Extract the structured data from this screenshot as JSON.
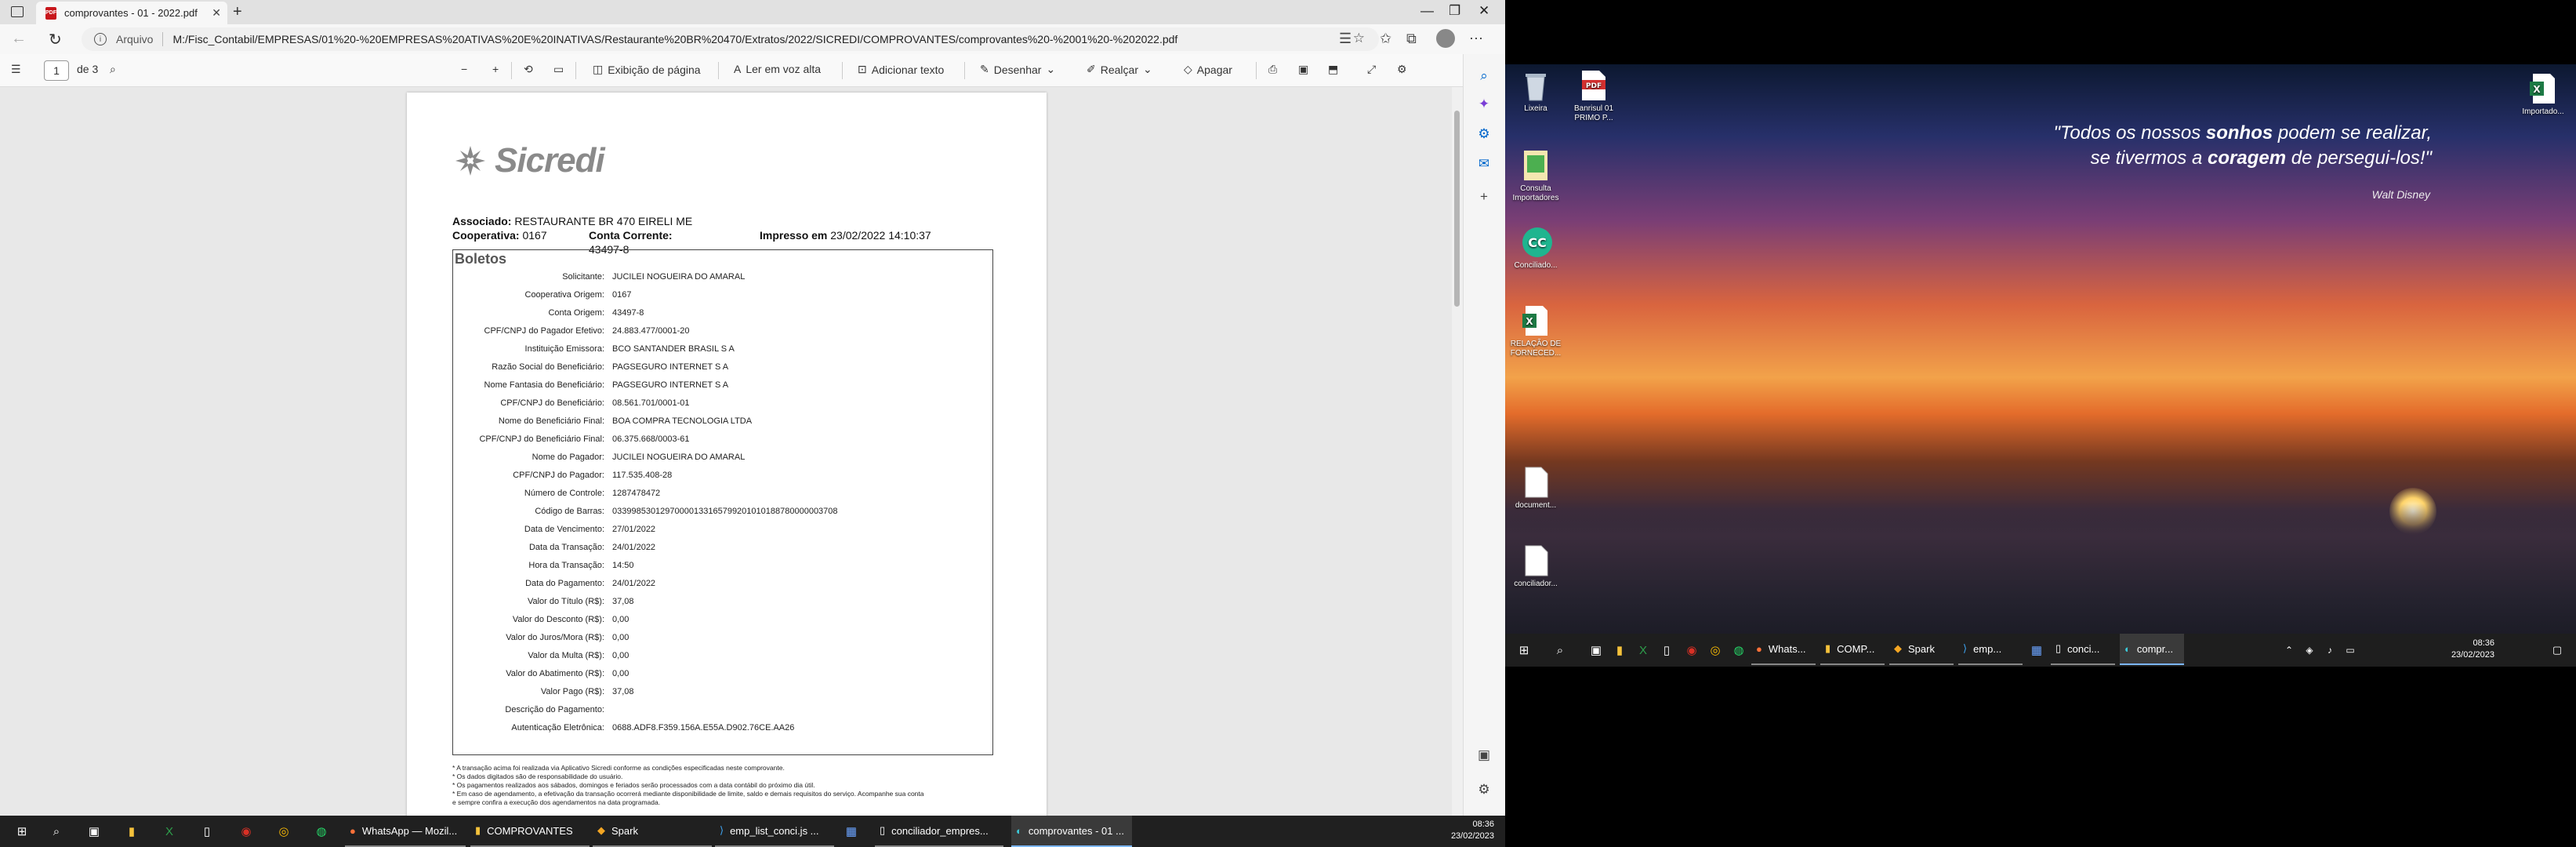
{
  "browser": {
    "tab_title": "comprovantes - 01 - 2022.pdf",
    "url_scheme_label": "Arquivo",
    "url": "M:/Fisc_Contabil/EMPRESAS/01%20-%20EMPRESAS%20ATIVAS%20E%20INATIVAS/Restaurante%20BR%20470/Extratos/2022/SICREDI/COMPROVANTES/comprovantes%20-%2001%20-%202022.pdf"
  },
  "pdf_toolbar": {
    "page_number": "1",
    "page_total": "de 3",
    "view_label": "Exibição de página",
    "read_aloud_label": "Ler em voz alta",
    "add_text_label": "Adicionar texto",
    "draw_label": "Desenhar",
    "highlight_label": "Realçar",
    "erase_label": "Apagar"
  },
  "doc": {
    "logo_text": "Sicredi",
    "associado_label": "Associado:",
    "associado": "RESTAURANTE BR 470 EIRELI ME",
    "cooperativa_label": "Cooperativa:",
    "cooperativa": "0167",
    "conta_label": "Conta Corrente:",
    "conta": "43497-8",
    "impresso_label": "Impresso em",
    "impresso": "23/02/2022 14:10:37",
    "section_title": "Boletos",
    "rows": [
      {
        "label": "Solicitante:",
        "value": "JUCILEI NOGUEIRA DO AMARAL"
      },
      {
        "label": "Cooperativa Origem:",
        "value": "0167"
      },
      {
        "label": "Conta Origem:",
        "value": "43497-8"
      },
      {
        "label": "CPF/CNPJ do Pagador Efetivo:",
        "value": "24.883.477/0001-20"
      },
      {
        "label": "Instituição Emissora:",
        "value": "BCO SANTANDER BRASIL S A"
      },
      {
        "label": "Razão Social do Beneficiário:",
        "value": "PAGSEGURO INTERNET S A"
      },
      {
        "label": "Nome Fantasia do Beneficiário:",
        "value": "PAGSEGURO INTERNET S A"
      },
      {
        "label": "CPF/CNPJ do Beneficiário:",
        "value": "08.561.701/0001-01"
      },
      {
        "label": "Nome do Beneficiário Final:",
        "value": "BOA COMPRA TECNOLOGIA LTDA"
      },
      {
        "label": "CPF/CNPJ do Beneficiário Final:",
        "value": "06.375.668/0003-61"
      },
      {
        "label": "Nome do Pagador:",
        "value": "JUCILEI NOGUEIRA DO AMARAL"
      },
      {
        "label": "CPF/CNPJ do Pagador:",
        "value": "117.535.408-28"
      },
      {
        "label": "Número de Controle:",
        "value": "1287478472"
      },
      {
        "label": "Código de Barras:",
        "value": "03399853012970000133165799201010188780000003708"
      },
      {
        "label": "Data de Vencimento:",
        "value": "27/01/2022"
      },
      {
        "label": "Data da Transação:",
        "value": "24/01/2022"
      },
      {
        "label": "Hora da Transação:",
        "value": "14:50"
      },
      {
        "label": "Data do Pagamento:",
        "value": "24/01/2022"
      },
      {
        "label": "Valor do Título (R$):",
        "value": "37,08"
      },
      {
        "label": "Valor do Desconto (R$):",
        "value": "0,00"
      },
      {
        "label": "Valor do Juros/Mora (R$):",
        "value": "0,00"
      },
      {
        "label": "Valor da Multa (R$):",
        "value": "0,00"
      },
      {
        "label": "Valor do Abatimento (R$):",
        "value": "0,00"
      },
      {
        "label": "Valor Pago (R$):",
        "value": "37,08"
      },
      {
        "label": "Descrição do Pagamento:",
        "value": ""
      },
      {
        "label": "Autenticação Eletrônica:",
        "value": "0688.ADF8.F359.156A.E55A.D902.76CE.AA26"
      }
    ],
    "notes": [
      "* A transação acima foi realizada via Aplicativo Sicredi conforme as condições especificadas neste comprovante.",
      "* Os dados digitados são de responsabilidade do usuário.",
      "* Os pagamentos realizados aos sábados, domingos e feriados serão processados com a data contábil do próximo dia útil.",
      "* Em caso de agendamento, a efetivação da transação ocorrerá mediante disponibilidade de limite, saldo e demais requisitos do serviço. Acompanhe sua conta",
      "e sempre confira a execução dos agendamentos na data programada."
    ]
  },
  "taskbar_left": {
    "apps": [
      "WhatsApp — Mozil...",
      "COMPROVANTES",
      "Spark",
      "emp_list_conci.js ...",
      "conciliador_empres...",
      "comprovantes - 01 ..."
    ],
    "time": "08:36",
    "date": "23/02/2023"
  },
  "desktop": {
    "quote_line1_a": "\"Todos os nossos ",
    "quote_line1_b": "sonhos",
    "quote_line1_c": " podem se realizar,",
    "quote_line2_a": "se tivermos a ",
    "quote_line2_b": "coragem",
    "quote_line2_c": " de persegui-los!\"",
    "quote_author": "Walt Disney",
    "icons": [
      "Lixeira",
      "Banrisul 01 PRIMO P...",
      "Consulta Importadores",
      "Conciliado...",
      "RELAÇÃO DE FORNECED...",
      "document...",
      "conciliador...",
      "Importado..."
    ]
  },
  "taskbar_right": {
    "apps": [
      "Whats...",
      "COMP...",
      "Spark",
      "emp...",
      "conci...",
      "compr..."
    ],
    "time": "08:36",
    "date": "23/02/2023"
  }
}
